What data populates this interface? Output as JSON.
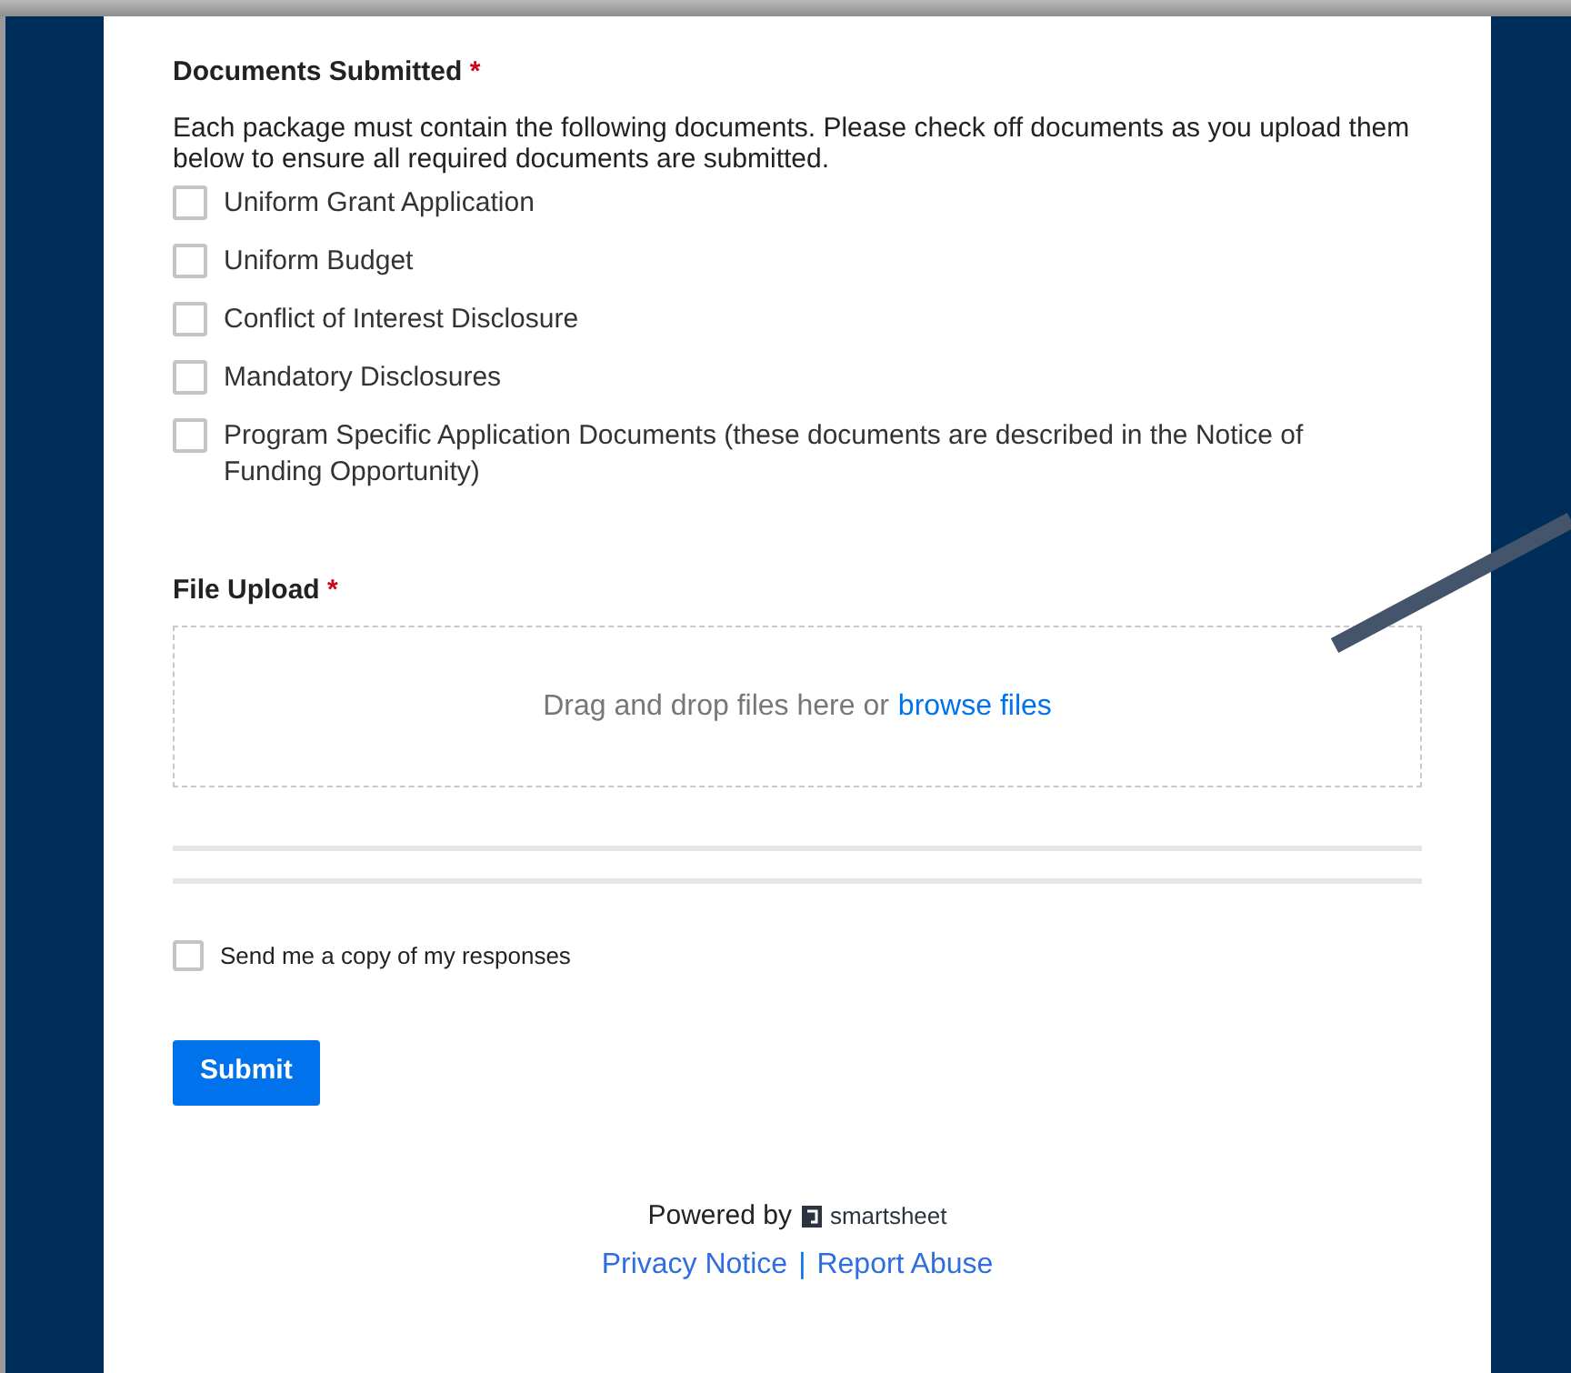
{
  "documents": {
    "label": "Documents Submitted",
    "required_mark": "*",
    "description": "Each package must contain the following documents. Please check off documents as you upload them below to ensure all required documents are submitted.",
    "items": [
      {
        "label": "Uniform Grant Application",
        "checked": false
      },
      {
        "label": "Uniform Budget",
        "checked": false
      },
      {
        "label": "Conflict of Interest Disclosure",
        "checked": false
      },
      {
        "label": "Mandatory Disclosures",
        "checked": false
      },
      {
        "label": "Program Specific Application Documents (these documents are described in the Notice of Funding Opportunity)",
        "checked": false
      }
    ]
  },
  "file_upload": {
    "label": "File Upload",
    "required_mark": "*",
    "prompt": "Drag and drop files here or",
    "link": "browse files"
  },
  "send_copy": {
    "label": "Send me a copy of my responses",
    "checked": false
  },
  "submit": "Submit",
  "footer": {
    "powered_by": "Powered by",
    "brand": "smartsheet",
    "links": [
      "Privacy Notice",
      "Report Abuse"
    ],
    "separator": "|"
  }
}
